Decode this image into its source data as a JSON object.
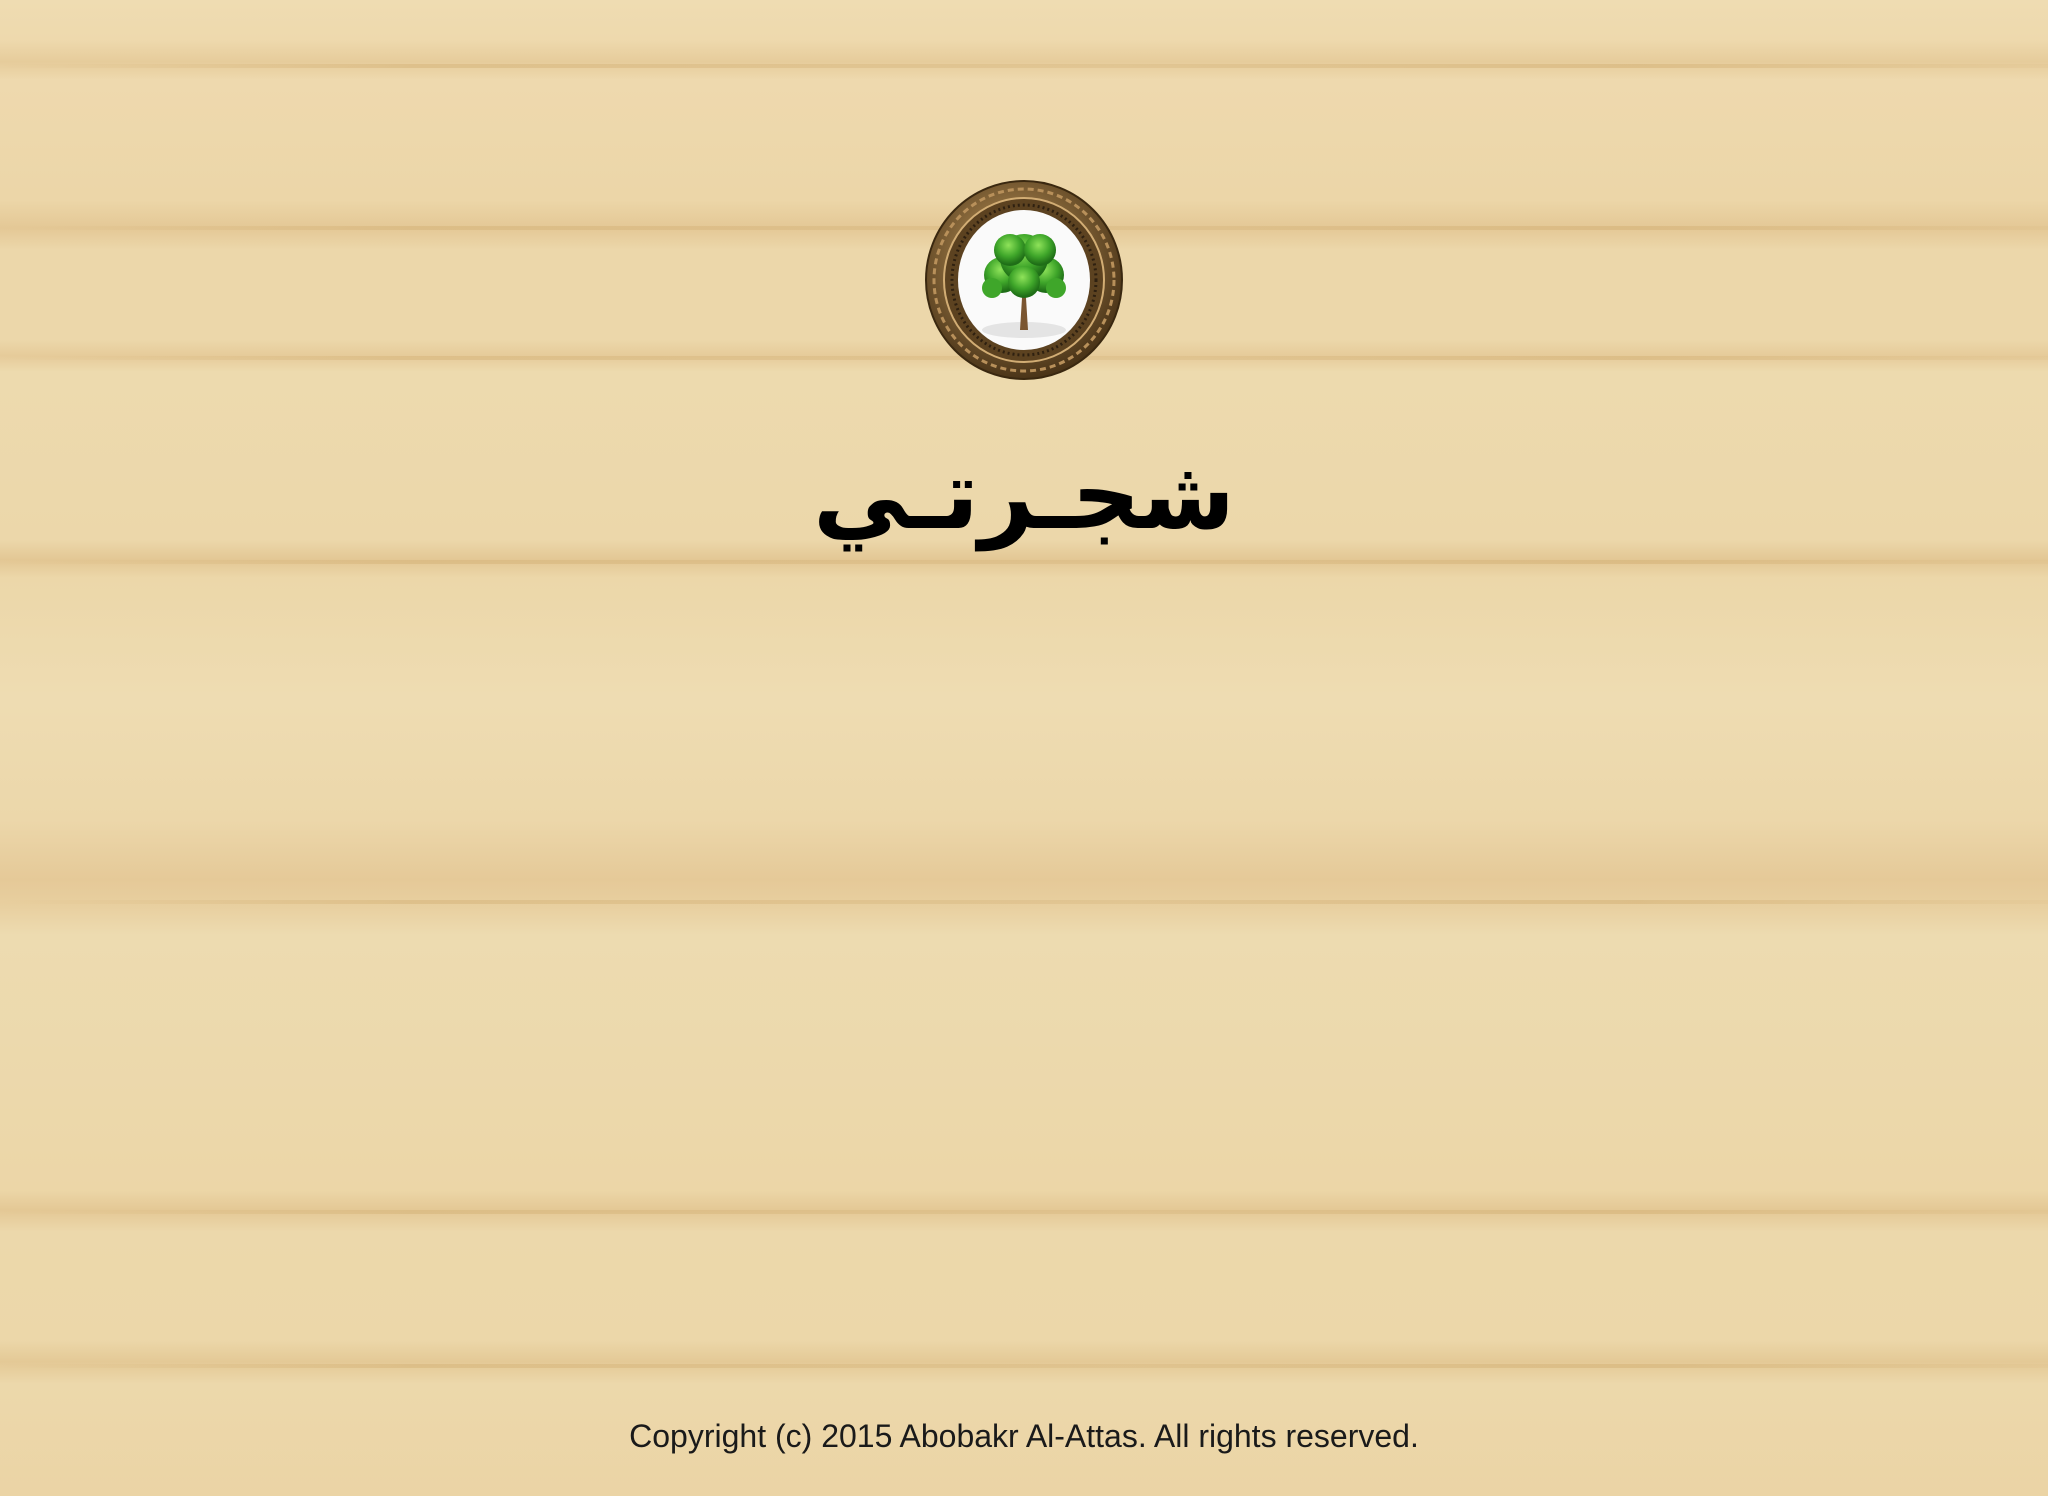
{
  "screen": {
    "background": "wood-texture",
    "colors": {
      "wood_light": "#ecd6a8",
      "wood_grain": "#e2c592",
      "frame_bronze": "#8a6a3c",
      "tree_green": "#3fa62a",
      "title_text": "#000000",
      "footer_text": "#1a1a1a"
    }
  },
  "logo": {
    "icon": "tree-in-ornate-frame-icon"
  },
  "title": {
    "text": "شجـرتـي"
  },
  "footer": {
    "copyright": "Copyright (c) 2015 Abobakr Al-Attas. All rights reserved."
  }
}
